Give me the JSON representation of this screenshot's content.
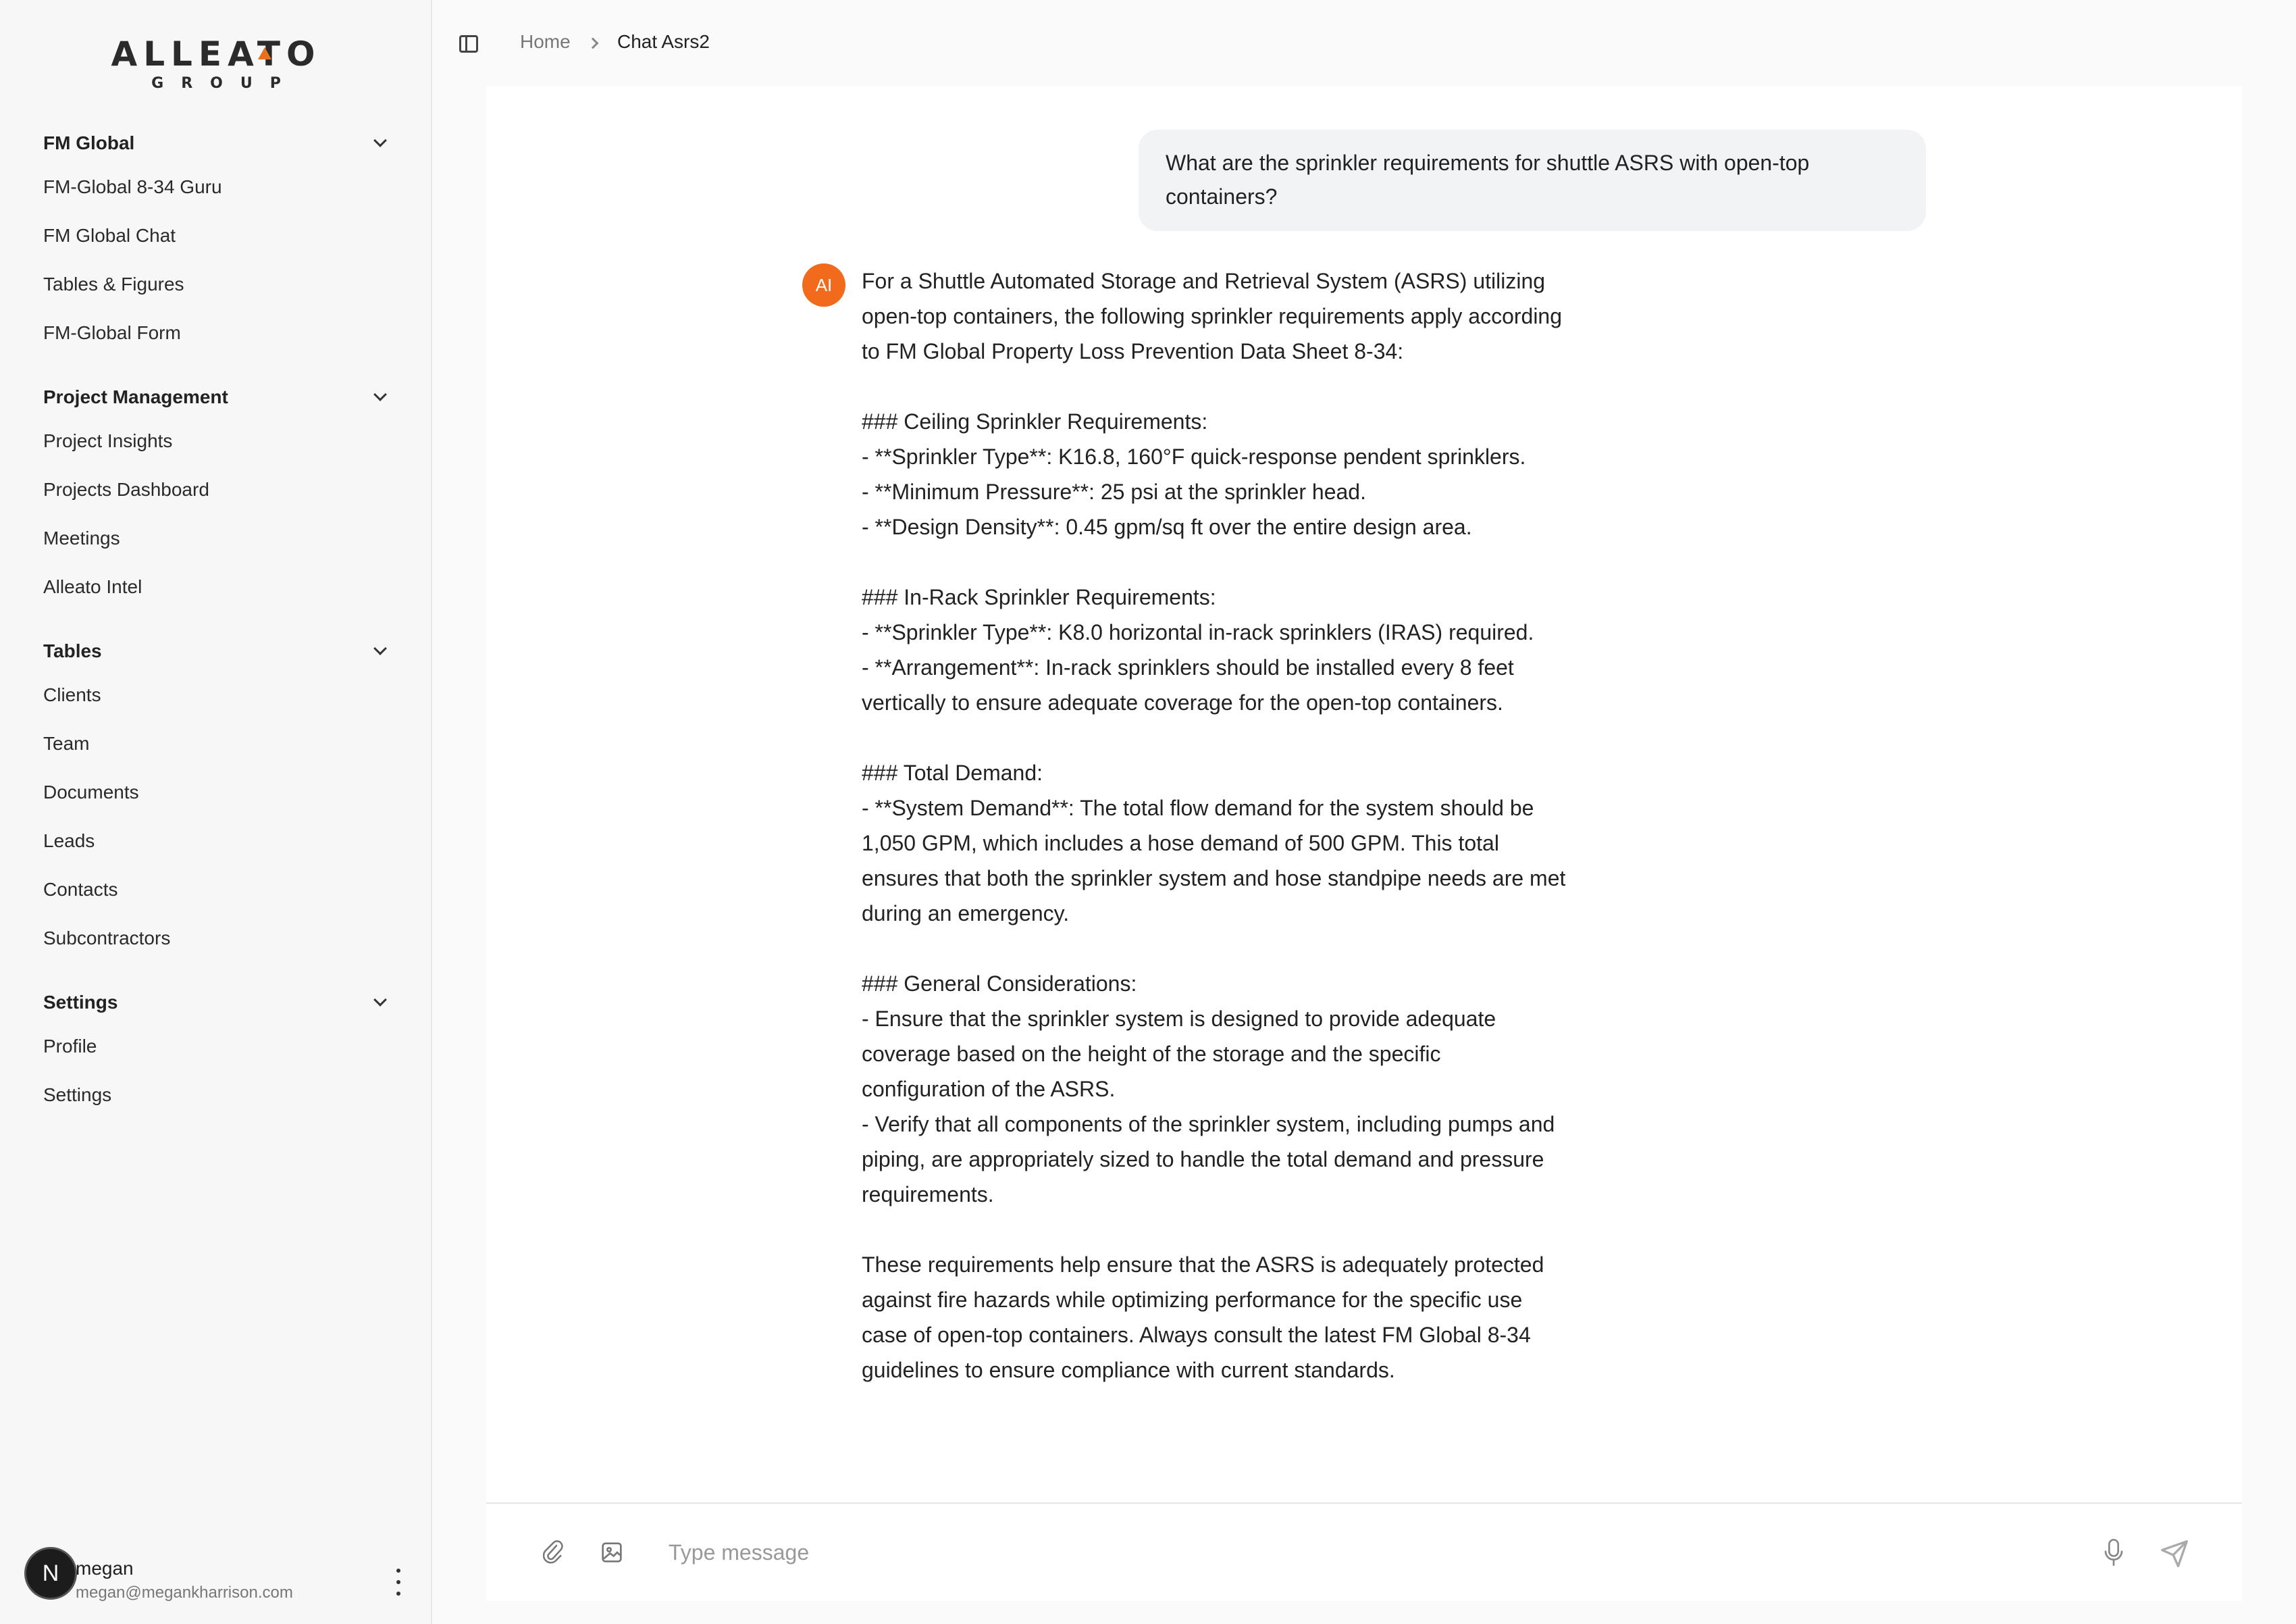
{
  "brand": {
    "name": "ALLEATO",
    "subtitle": "GROUP"
  },
  "sidebar": {
    "groups": [
      {
        "title": "FM Global",
        "items": [
          "FM-Global 8-34 Guru",
          "FM Global Chat",
          "Tables & Figures",
          "FM-Global Form"
        ]
      },
      {
        "title": "Project Management",
        "items": [
          "Project Insights",
          "Projects Dashboard",
          "Meetings",
          "Alleato Intel"
        ]
      },
      {
        "title": "Tables",
        "items": [
          "Clients",
          "Team",
          "Documents",
          "Leads",
          "Contacts",
          "Subcontractors"
        ]
      },
      {
        "title": "Settings",
        "items": [
          "Profile",
          "Settings"
        ]
      }
    ],
    "user": {
      "initial": "N",
      "name": "megan",
      "email": "megan@megankharrison.com"
    }
  },
  "breadcrumb": {
    "home": "Home",
    "current": "Chat Asrs2"
  },
  "chat": {
    "user_message": "What are the sprinkler requirements for shuttle ASRS with open-top containers?",
    "ai_label": "AI",
    "ai_message": "For a Shuttle Automated Storage and Retrieval System (ASRS) utilizing\nopen-top containers, the following sprinkler requirements apply according\nto FM Global Property Loss Prevention Data Sheet 8-34:\n\n### Ceiling Sprinkler Requirements:\n- **Sprinkler Type**: K16.8, 160°F quick-response pendent sprinklers.\n- **Minimum Pressure**: 25 psi at the sprinkler head.\n- **Design Density**: 0.45 gpm/sq ft over the entire design area.\n\n### In-Rack Sprinkler Requirements:\n- **Sprinkler Type**: K8.0 horizontal in-rack sprinklers (IRAS) required.\n- **Arrangement**: In-rack sprinklers should be installed every 8 feet\nvertically to ensure adequate coverage for the open-top containers.\n\n### Total Demand:\n- **System Demand**: The total flow demand for the system should be\n1,050 GPM, which includes a hose demand of 500 GPM. This total\nensures that both the sprinkler system and hose standpipe needs are met\nduring an emergency.\n\n### General Considerations:\n- Ensure that the sprinkler system is designed to provide adequate\ncoverage based on the height of the storage and the specific\nconfiguration of the ASRS.\n- Verify that all components of the sprinkler system, including pumps and\npiping, are appropriately sized to handle the total demand and pressure\nrequirements.\n\nThese requirements help ensure that the ASRS is adequately protected\nagainst fire hazards while optimizing performance for the specific use\ncase of open-top containers. Always consult the latest FM Global 8-34\nguidelines to ensure compliance with current standards."
  },
  "composer": {
    "placeholder": "Type message",
    "value": ""
  },
  "colors": {
    "accent": "#f26a1b",
    "sidebar_bg": "#f7f7f7",
    "bubble_bg": "#f2f3f5"
  }
}
